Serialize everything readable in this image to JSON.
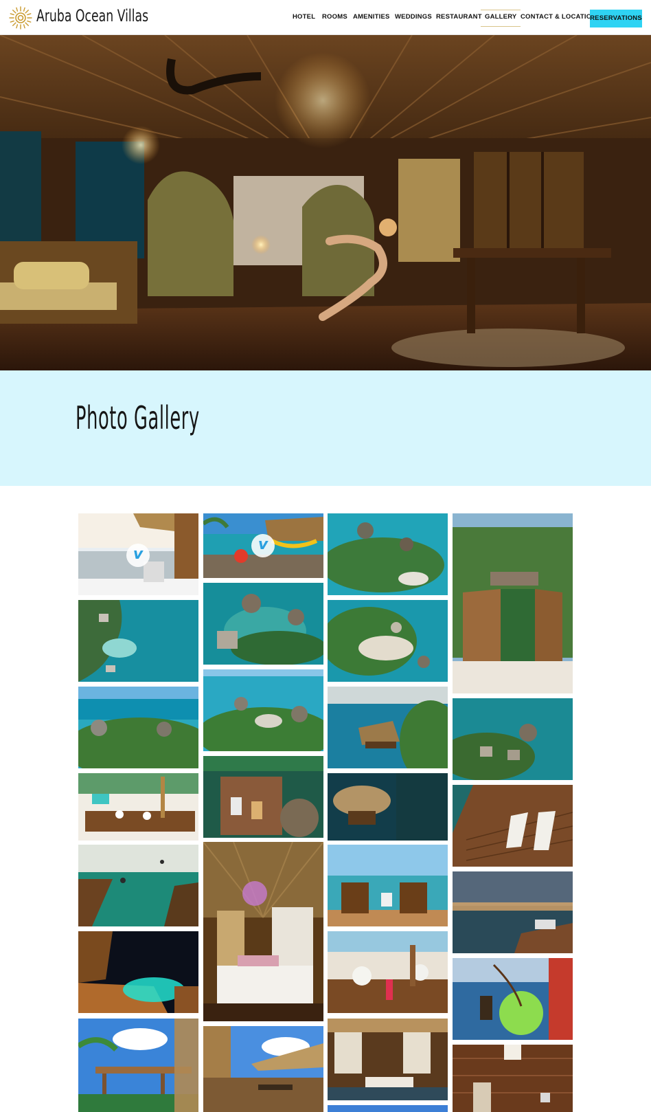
{
  "header": {
    "brand": "Aruba Ocean Villas",
    "logo_icon": "sun-logo-icon",
    "nav": [
      "HOTEL",
      "ROOMS",
      "AMENITIES",
      "WEDDINGS",
      "RESTAURANT",
      "GALLERY",
      "CONTACT & LOCATION"
    ],
    "active_nav": "GALLERY",
    "reservations_label": "RESERVATIONS",
    "accent_color": "#2fd3f3"
  },
  "hero": {
    "image_icon": "villa-interior-photo"
  },
  "title_band": {
    "title": "Photo Gallery",
    "background_color": "#d7f6fd"
  },
  "gallery": {
    "video_icon": "vimeo-play-icon",
    "video_glyph": "v",
    "column_count": 4,
    "photo_count": 32
  }
}
